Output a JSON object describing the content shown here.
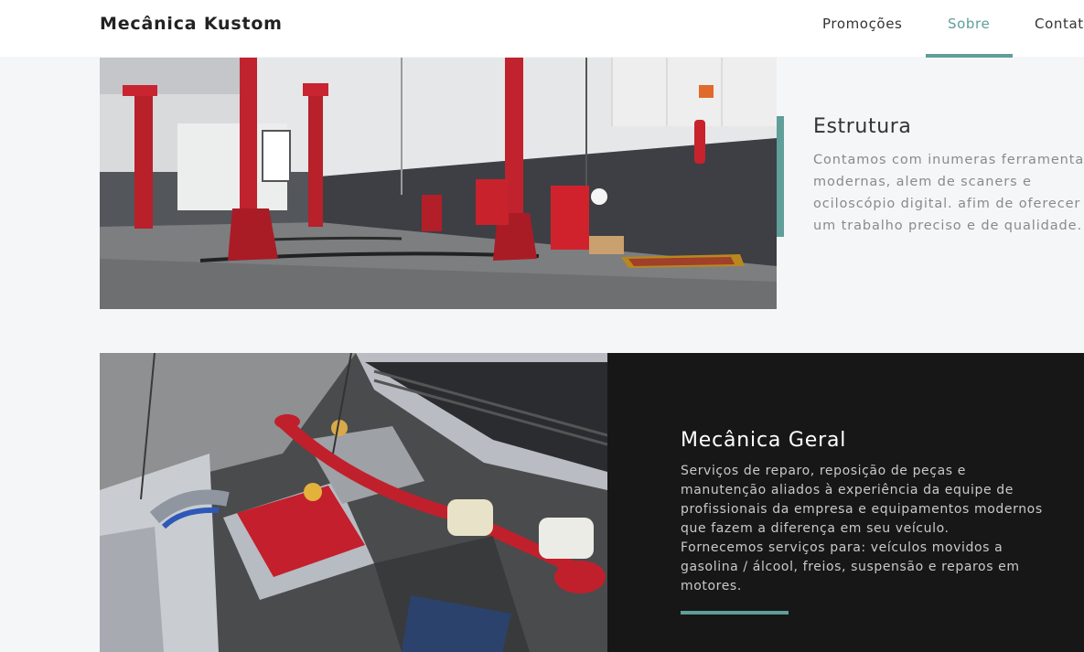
{
  "header": {
    "brand": "Mecânica Kustom",
    "nav": [
      {
        "label": "Promoções",
        "active": false
      },
      {
        "label": "Sobre",
        "active": true
      },
      {
        "label": "Contat",
        "active": false
      }
    ]
  },
  "sections": [
    {
      "title": "Estrutura",
      "text": "Contamos com inumeras ferramentas modernas, alem de scaners e ociloscópio digital. afim de oferecer um trabalho preciso e de qualidade."
    },
    {
      "title": "Mecânica Geral",
      "paragraph1": "Serviços de reparo, reposição de peças e manutenção aliados à experiência da equipe de profissionais da empresa e equipamentos modernos que fazem a diferença em seu veículo.",
      "paragraph2": "Fornecemos serviços para: veículos movidos a gasolina / álcool, freios, suspensão e reparos em motores."
    }
  ],
  "colors": {
    "accent": "#5f9e99",
    "dark_panel": "#171717",
    "background": "#f5f6f8"
  }
}
